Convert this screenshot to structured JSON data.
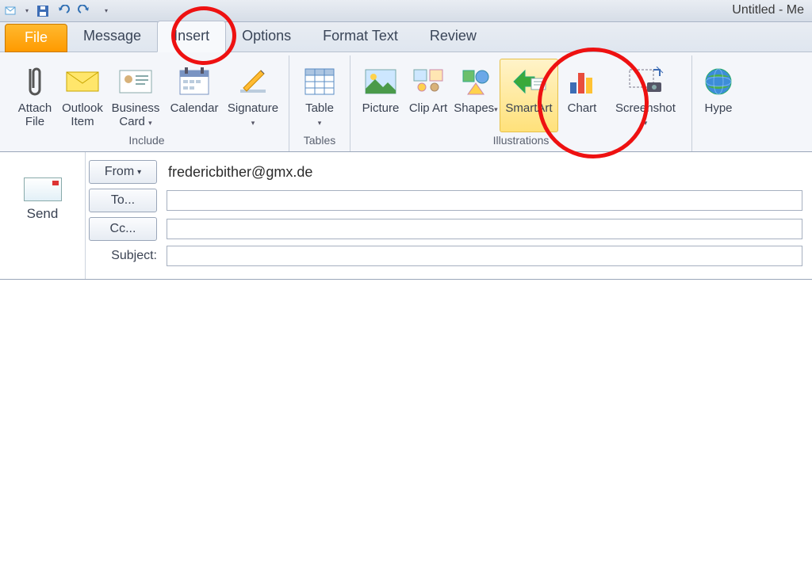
{
  "window": {
    "title": "Untitled - Me"
  },
  "tabs": {
    "file": "File",
    "items": [
      {
        "label": "Message",
        "active": false
      },
      {
        "label": "Insert",
        "active": true
      },
      {
        "label": "Options",
        "active": false
      },
      {
        "label": "Format Text",
        "active": false
      },
      {
        "label": "Review",
        "active": false
      }
    ]
  },
  "ribbon": {
    "groups": [
      {
        "name": "Include",
        "items": [
          {
            "id": "attach-file",
            "label": "Attach File",
            "icon": "paperclip",
            "dropdown": false
          },
          {
            "id": "outlook-item",
            "label": "Outlook Item",
            "icon": "envelope",
            "dropdown": false
          },
          {
            "id": "business-card",
            "label": "Business Card",
            "icon": "card",
            "dropdown": true
          },
          {
            "id": "calendar",
            "label": "Calendar",
            "icon": "calendar",
            "dropdown": false
          },
          {
            "id": "signature",
            "label": "Signature",
            "icon": "pen",
            "dropdown": true
          }
        ]
      },
      {
        "name": "Tables",
        "items": [
          {
            "id": "table",
            "label": "Table",
            "icon": "table",
            "dropdown": true
          }
        ]
      },
      {
        "name": "Illustrations",
        "items": [
          {
            "id": "picture",
            "label": "Picture",
            "icon": "picture",
            "dropdown": false
          },
          {
            "id": "clip-art",
            "label": "Clip Art",
            "icon": "clipart",
            "dropdown": false
          },
          {
            "id": "shapes",
            "label": "Shapes",
            "icon": "shapes",
            "dropdown": true
          },
          {
            "id": "smartart",
            "label": "SmartArt",
            "icon": "smartart",
            "dropdown": false,
            "highlight": true
          },
          {
            "id": "chart",
            "label": "Chart",
            "icon": "chart",
            "dropdown": false
          },
          {
            "id": "screenshot",
            "label": "Screenshot",
            "icon": "screenshot",
            "dropdown": true
          }
        ]
      },
      {
        "name": "",
        "items": [
          {
            "id": "hyperlink",
            "label": "Hype",
            "icon": "globe",
            "dropdown": false
          }
        ]
      }
    ]
  },
  "compose": {
    "send": "Send",
    "from_label": "From",
    "to_label": "To...",
    "cc_label": "Cc...",
    "subject_label": "Subject:",
    "from_value": "fredericbither@gmx.de",
    "to_value": "",
    "cc_value": "",
    "subject_value": ""
  },
  "annotations": {
    "circles": [
      "insert-tab",
      "smartart-button"
    ]
  }
}
